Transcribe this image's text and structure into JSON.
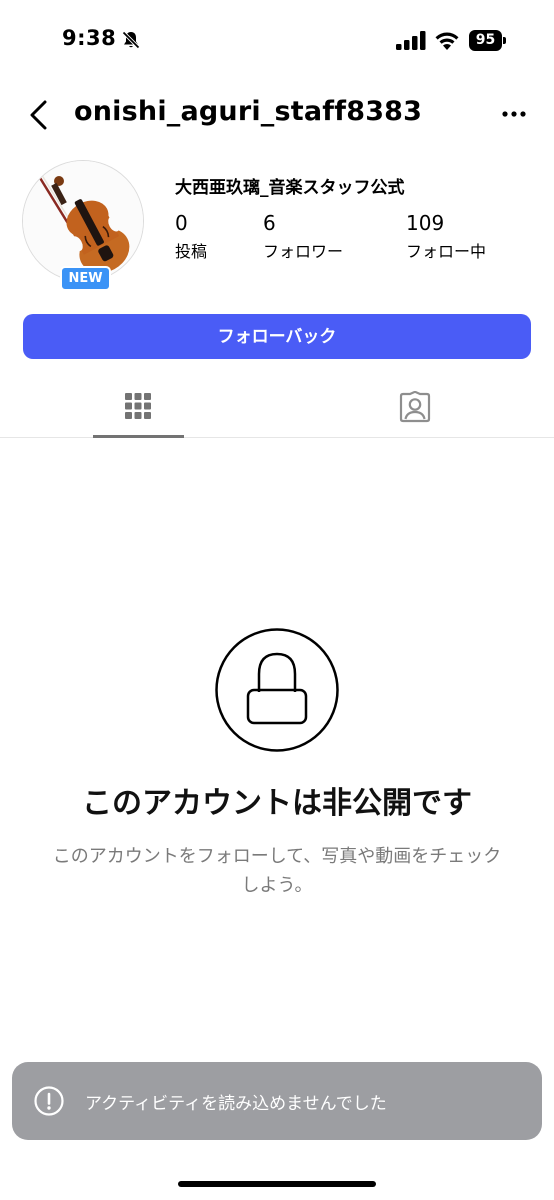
{
  "status_bar": {
    "time": "9:38",
    "battery": "95",
    "icons": [
      "bell-slash-icon",
      "cellular-signal-icon",
      "wifi-icon",
      "battery-icon"
    ]
  },
  "header": {
    "username": "onishi_aguri_staff8383",
    "icons": [
      "chevron-left-icon",
      "more-horizontal-icon"
    ]
  },
  "profile": {
    "display_name": "大西亜玖璃_音楽スタッフ公式",
    "new_badge": "NEW",
    "stats": [
      {
        "value": "0",
        "label": "投稿"
      },
      {
        "value": "6",
        "label": "フォロワー"
      },
      {
        "value": "109",
        "label": "フォロー中"
      }
    ]
  },
  "follow_button": {
    "label": "フォローバック",
    "color": "#4a5cf6"
  },
  "tabs": [
    {
      "icon": "grid-icon",
      "active": true
    },
    {
      "icon": "tagged-person-icon",
      "active": false
    }
  ],
  "private_notice": {
    "icon": "lock-icon",
    "title": "このアカウントは非公開です",
    "description": "このアカウントをフォローして、写真や動画をチェックしよう。"
  },
  "toast": {
    "icon": "alert-circle-icon",
    "message": "アクティビティを読み込めませんでした"
  }
}
